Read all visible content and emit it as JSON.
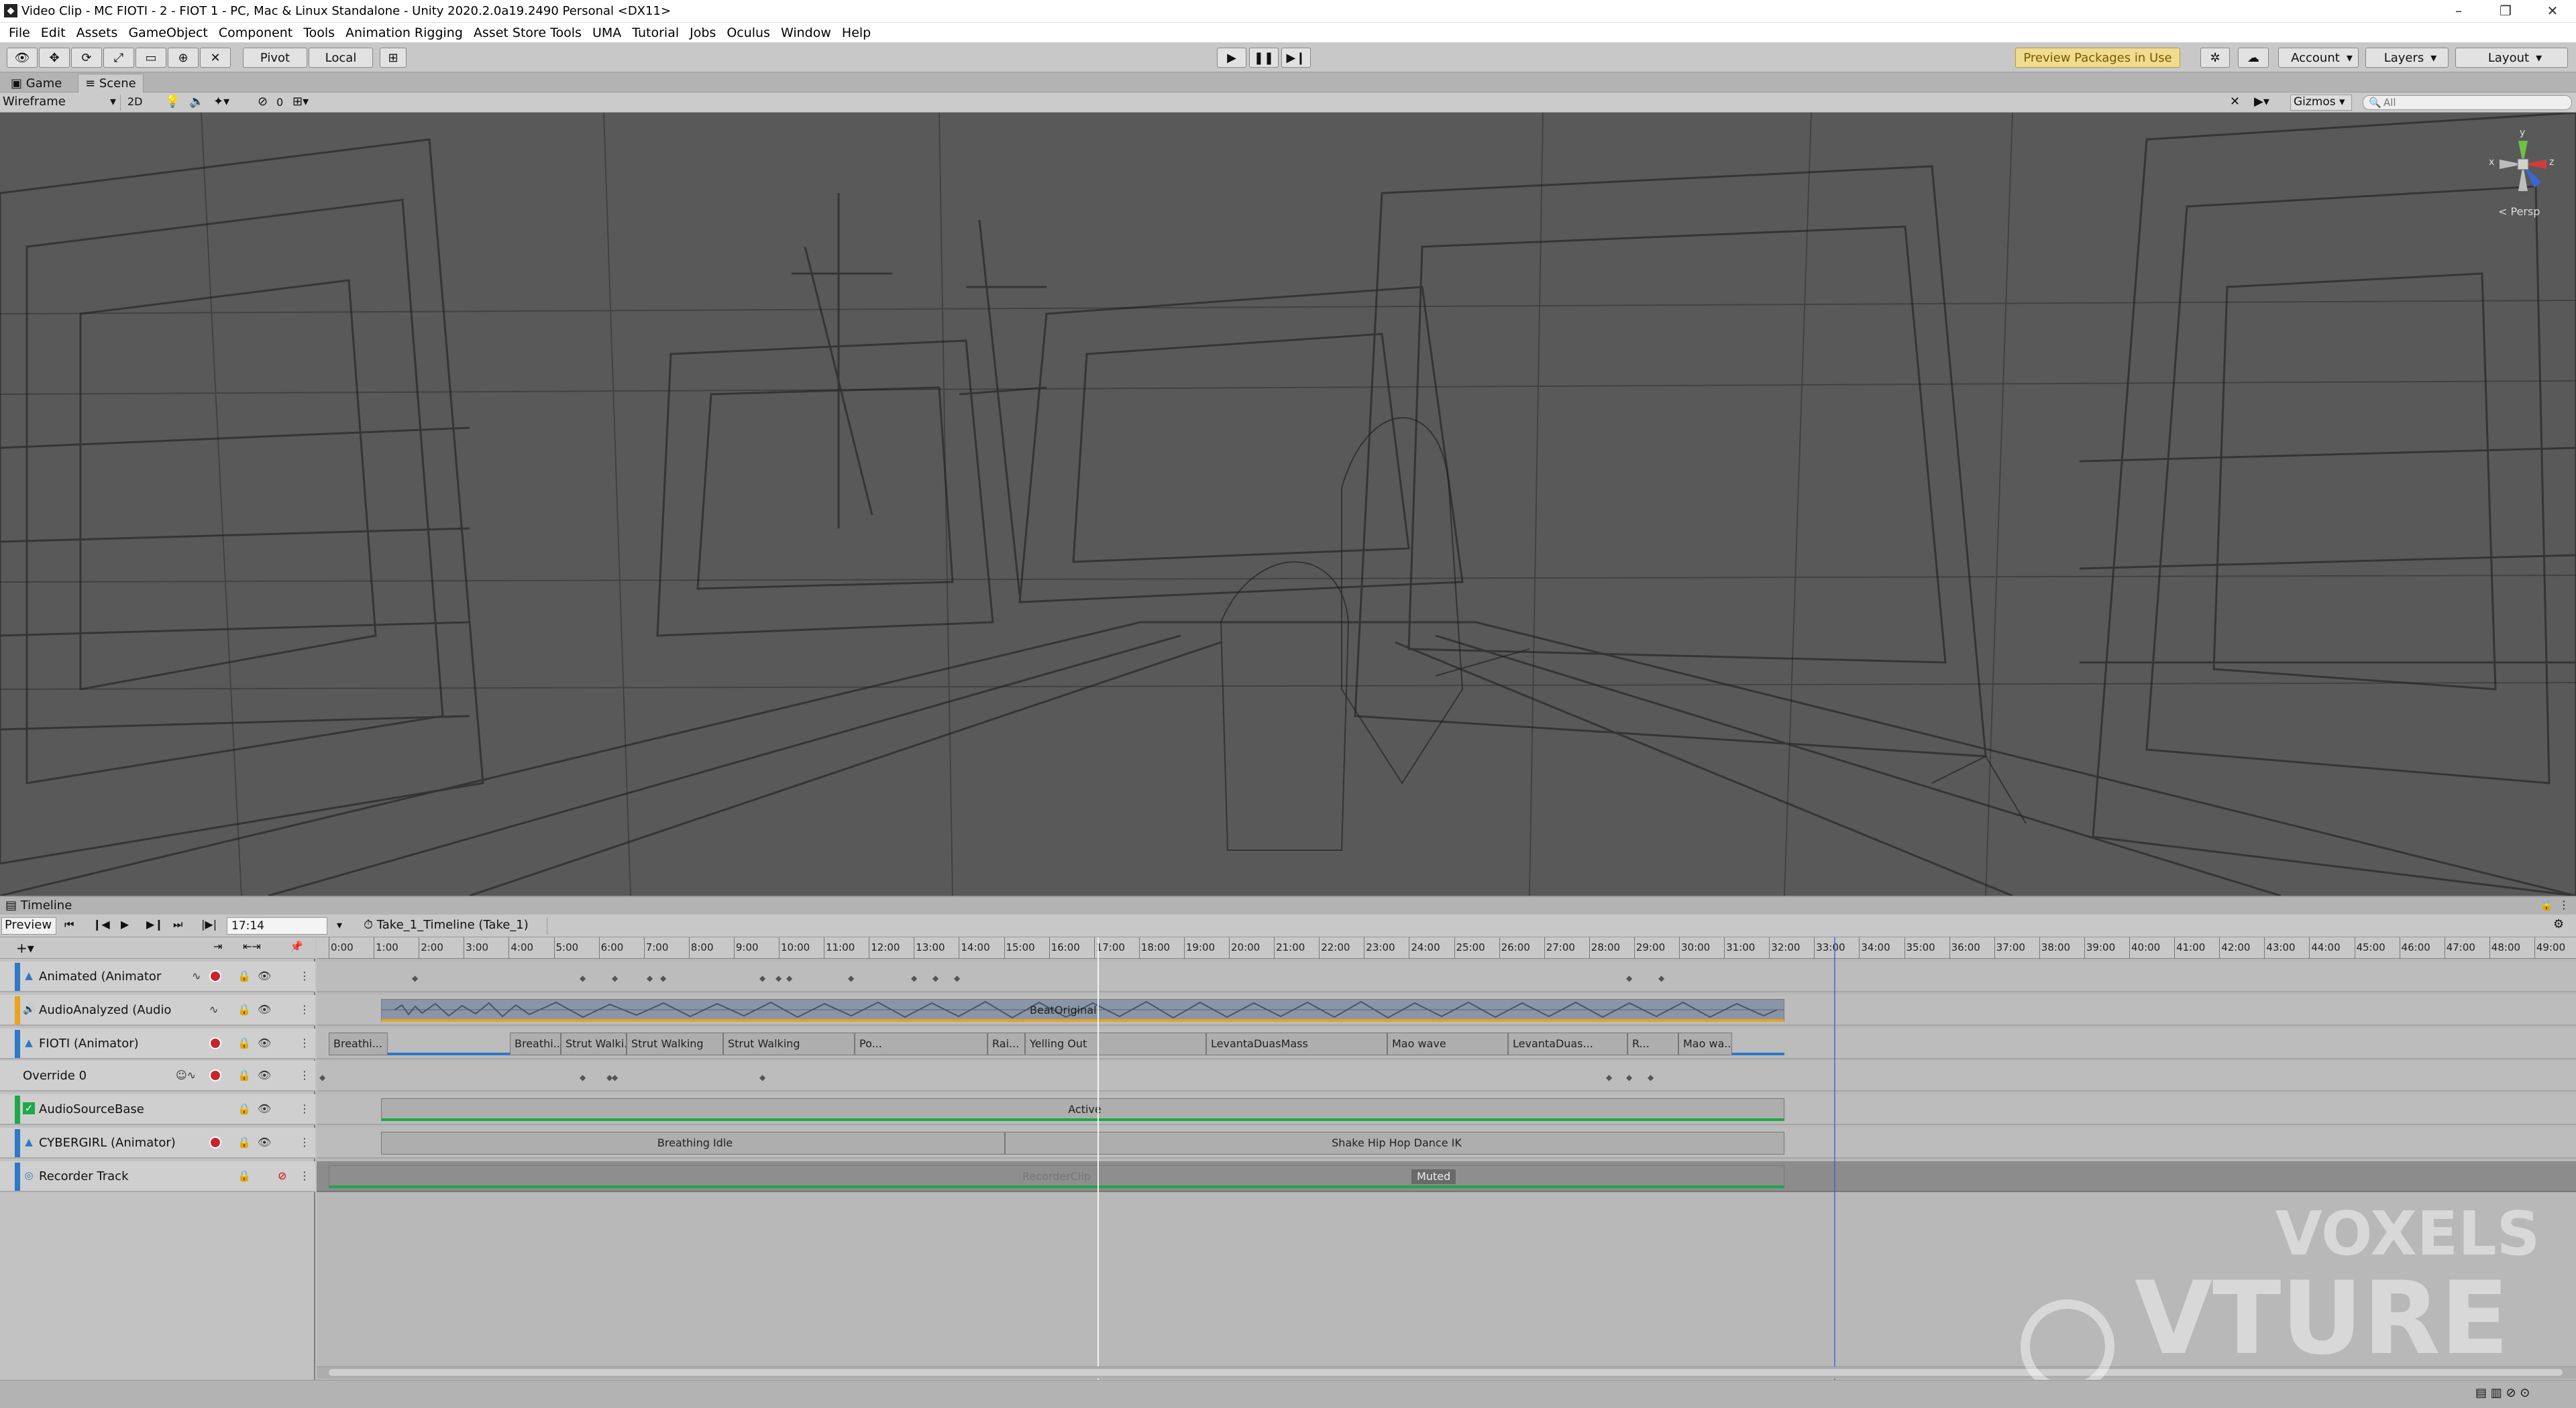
{
  "window": {
    "title": "Video Clip - MC FIOTI - 2 - FIOT 1 - PC, Mac & Linux Standalone - Unity 2020.2.0a19.2490 Personal <DX11>"
  },
  "menu": [
    "File",
    "Edit",
    "Assets",
    "GameObject",
    "Component",
    "Tools",
    "Animation Rigging",
    "Asset Store Tools",
    "UMA",
    "Tutorial",
    "Jobs",
    "Oculus",
    "Window",
    "Help"
  ],
  "toolbar": {
    "pivot": "Pivot",
    "local": "Local",
    "preview_packages": "Preview Packages in Use",
    "account": "Account",
    "layers": "Layers",
    "layout": "Layout"
  },
  "tabs": {
    "game": "Game",
    "scene": "Scene"
  },
  "scenebar": {
    "shading": "Wireframe",
    "mode2d": "2D",
    "hidden_count": "0",
    "gizmos": "Gizmos",
    "search_placeholder": "All"
  },
  "gizmo": {
    "label": "< Persp",
    "x": "x",
    "y": "y",
    "z": "z"
  },
  "timeline": {
    "title": "Timeline",
    "preview": "Preview",
    "time": "17:14",
    "asset": "Take_1_Timeline (Take_1)",
    "ruler": [
      "0:00",
      "1:00",
      "2:00",
      "3:00",
      "4:00",
      "5:00",
      "6:00",
      "7:00",
      "8:00",
      "9:00",
      "10:00",
      "11:00",
      "12:00",
      "13:00",
      "14:00",
      "15:00",
      "16:00",
      "17:00",
      "18:00",
      "19:00",
      "20:00",
      "21:00",
      "22:00",
      "23:00",
      "24:00",
      "25:00",
      "26:00",
      "27:00",
      "28:00",
      "29:00",
      "30:00",
      "31:00",
      "32:00",
      "33:00",
      "34:00",
      "35:00",
      "36:00",
      "37:00",
      "38:00",
      "39:00",
      "40:00",
      "41:00",
      "42:00",
      "43:00",
      "44:00",
      "45:00",
      "46:00",
      "47:00",
      "48:00",
      "49:00"
    ],
    "tracks": [
      {
        "name": "Animated (Animator",
        "color": "#2e78c8",
        "rec": true
      },
      {
        "name": "AudioAnalyzed (Audio",
        "color": "#e8a21e",
        "rec": false
      },
      {
        "name": "FIOTI (Animator)",
        "color": "#2e78c8",
        "rec": true
      },
      {
        "name": "Override 0",
        "color": "",
        "rec": true
      },
      {
        "name": "AudioSourceBase",
        "color": "#1ea84a",
        "rec": false
      },
      {
        "name": "CYBERGIRL (Animator)",
        "color": "#2e78c8",
        "rec": true
      },
      {
        "name": "Recorder Track",
        "color": "#2e78c8",
        "rec": false
      }
    ],
    "clips": {
      "audio": "BeatOriginal",
      "fioti": [
        "Breathi...",
        "Breathi...",
        "Strut Walki...",
        "Strut Walking",
        "Strut Walking",
        "Po...",
        "Rai...",
        "Yelling Out",
        "LevantaDuasMass",
        "Mao wave",
        "LevantaDuas...",
        "R...",
        "Mao wa..."
      ],
      "active": "Active",
      "cyber": [
        "Breathing Idle",
        "Shake Hip Hop Dance IK"
      ],
      "recorder": "RecorderClip",
      "muted": "Muted"
    }
  },
  "watermark": {
    "top": "VOXELS",
    "bottom": "VTURE"
  }
}
